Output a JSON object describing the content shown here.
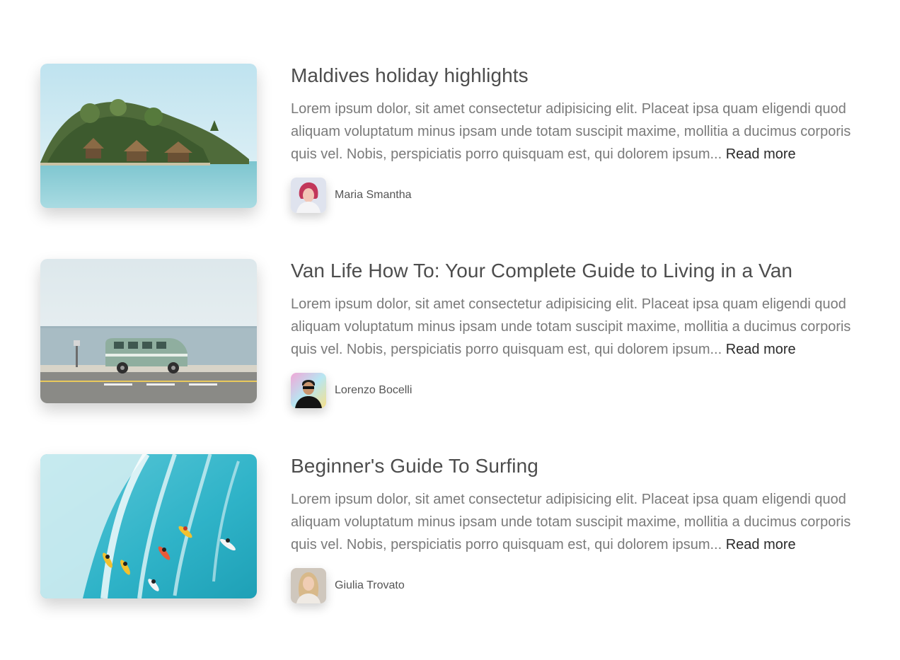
{
  "read_more_label": "Read more",
  "posts": [
    {
      "title": "Maldives holiday highlights",
      "excerpt": "Lorem ipsum dolor, sit amet consectetur adipisicing elit. Placeat ipsa quam eligendi quod aliquam voluptatum minus ipsam unde totam suscipit maxime, mollitia a ducimus corporis quis vel. Nobis, perspiciatis porro quisquam est, qui dolorem ipsum...",
      "author": "Maria Smantha",
      "image": "tropical-island-bungalows-image",
      "avatar": "woman-avatar"
    },
    {
      "title": "Van Life How To: Your Complete Guide to Living in a Van",
      "excerpt": "Lorem ipsum dolor, sit amet consectetur adipisicing elit. Placeat ipsa quam eligendi quod aliquam voluptatum minus ipsam unde totam suscipit maxime, mollitia a ducimus corporis quis vel. Nobis, perspiciatis porro quisquam est, qui dolorem ipsum...",
      "author": "Lorenzo Bocelli",
      "image": "van-by-sea-image",
      "avatar": "man-sunglasses-avatar"
    },
    {
      "title": "Beginner's Guide To Surfing",
      "excerpt": "Lorem ipsum dolor, sit amet consectetur adipisicing elit. Placeat ipsa quam eligendi quod aliquam voluptatum minus ipsam unde totam suscipit maxime, mollitia a ducimus corporis quis vel. Nobis, perspiciatis porro quisquam est, qui dolorem ipsum...",
      "author": "Giulia Trovato",
      "image": "surfers-on-wave-image",
      "avatar": "woman-blonde-avatar"
    }
  ]
}
